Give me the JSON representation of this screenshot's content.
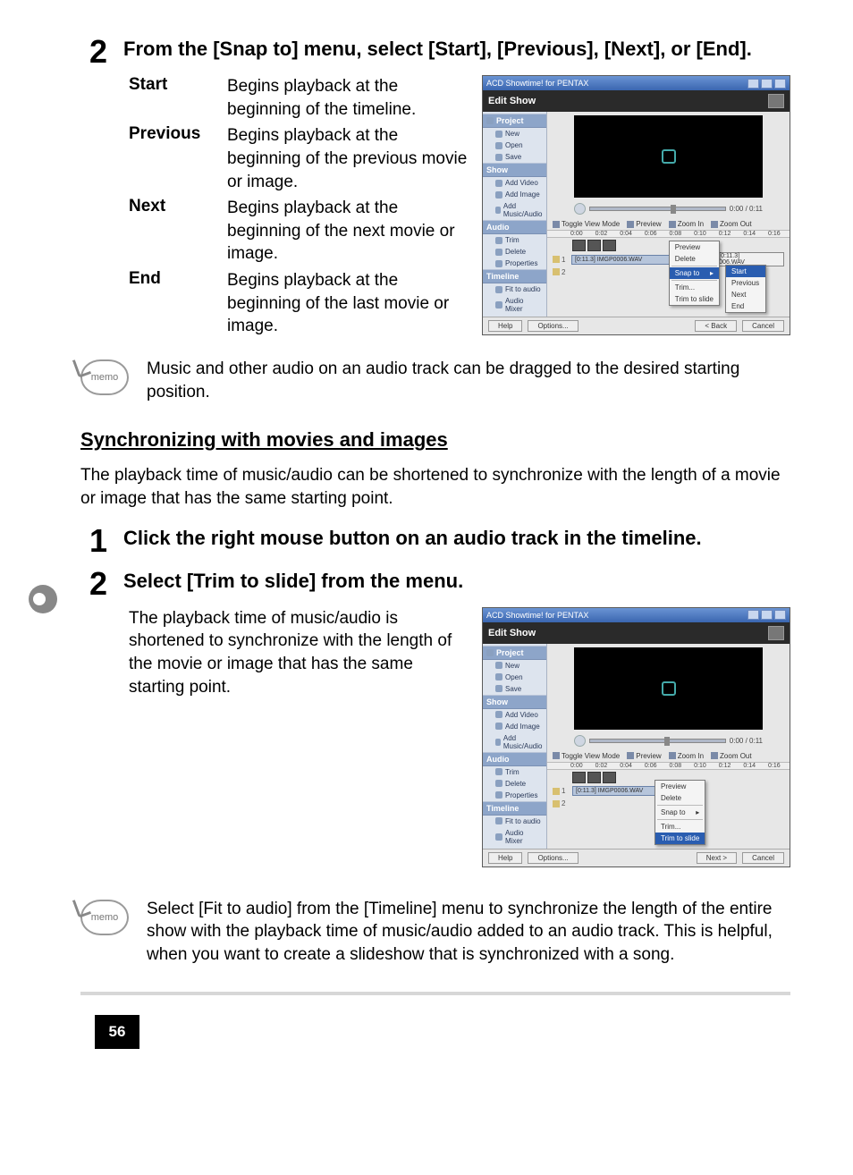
{
  "page_number": "56",
  "step2": {
    "num": "2",
    "title": "From the [Snap to] menu, select [Start], [Previous], [Next], or [End].",
    "defs": [
      {
        "term": "Start",
        "desc": "Begins playback at the beginning of the timeline."
      },
      {
        "term": "Previous",
        "desc": "Begins playback at the beginning of the previous movie or image."
      },
      {
        "term": "Next",
        "desc": "Begins playback at the beginning of the next movie or image."
      },
      {
        "term": "End",
        "desc": "Begins playback at the beginning of the last movie or image."
      }
    ]
  },
  "memo1": {
    "label": "memo",
    "text": "Music and other audio on an audio track can be dragged to the desired starting position."
  },
  "section_heading": "Synchronizing with movies and images",
  "section_intro": "The playback time of music/audio can be shortened to synchronize with the length of a movie or image that has the same starting point.",
  "sync_step1": {
    "num": "1",
    "title": "Click the right mouse button on an audio track in the timeline."
  },
  "sync_step2": {
    "num": "2",
    "title": "Select [Trim to slide] from the menu.",
    "body": "The playback time of music/audio is shortened to synchronize with the length of the movie or image that has the same starting point."
  },
  "memo2": {
    "label": "memo",
    "text": "Select [Fit to audio] from the [Timeline] menu to synchronize the length of the entire show with the playback time of music/audio added to an audio track. This is helpful, when you want to create a slideshow that is synchronized with a song."
  },
  "shot_a": {
    "title": "ACD Showtime! for PENTAX",
    "header": "Edit Show",
    "sidebar": {
      "sections": [
        {
          "name": "Project",
          "items": [
            "New",
            "Open",
            "Save"
          ]
        },
        {
          "name": "Show",
          "items": [
            "Add Video",
            "Add Image",
            "Add Music/Audio"
          ]
        },
        {
          "name": "Audio",
          "items": [
            "Trim",
            "Delete",
            "Properties"
          ]
        },
        {
          "name": "Timeline",
          "items": [
            "Fit to audio",
            "Audio Mixer"
          ]
        }
      ]
    },
    "transport_time": "0:00 / 0:11",
    "toolbar": {
      "toggle": "Toggle View Mode",
      "preview": "Preview",
      "zoom_in": "Zoom In",
      "zoom_out": "Zoom Out"
    },
    "ruler": [
      "0:00",
      "0:02",
      "0:04",
      "0:06",
      "0:08",
      "0:10",
      "0:12",
      "0:14",
      "0:16"
    ],
    "tracks": {
      "a1": "1",
      "a2": "2",
      "clip1": "[0:11.3] IMGP0006.WAV",
      "clip_info": "Audio: [0:11.3] IMGP0006.WAV"
    },
    "ctx_main": {
      "items": [
        "Preview",
        "Delete"
      ],
      "snap": "Snap to",
      "trim": "Trim...",
      "trimslide": "Trim to slide"
    },
    "ctx_snap": {
      "items": [
        "Start",
        "Previous",
        "Next",
        "End"
      ],
      "selected": "Start"
    },
    "bottom": {
      "help": "Help",
      "options": "Options...",
      "back": "< Back",
      "cancel": "Cancel"
    },
    "knob_left": "60%"
  },
  "shot_b": {
    "title": "ACD Showtime! for PENTAX",
    "header": "Edit Show",
    "sidebar": {
      "sections": [
        {
          "name": "Project",
          "items": [
            "New",
            "Open",
            "Save"
          ]
        },
        {
          "name": "Show",
          "items": [
            "Add Video",
            "Add Image",
            "Add Music/Audio"
          ]
        },
        {
          "name": "Audio",
          "items": [
            "Trim",
            "Delete",
            "Properties"
          ]
        },
        {
          "name": "Timeline",
          "items": [
            "Fit to audio",
            "Audio Mixer"
          ]
        }
      ]
    },
    "transport_time": "0:00 / 0:11",
    "toolbar": {
      "toggle": "Toggle View Mode",
      "preview": "Preview",
      "zoom_in": "Zoom In",
      "zoom_out": "Zoom Out"
    },
    "ruler": [
      "0:00",
      "0:02",
      "0:04",
      "0:06",
      "0:08",
      "0:10",
      "0:12",
      "0:14",
      "0:16"
    ],
    "tracks": {
      "a1": "1",
      "a2": "2",
      "clip1": "[0:11.3] IMGP0006.WAV"
    },
    "ctx_main": {
      "items": [
        "Preview",
        "Delete"
      ],
      "snap": "Snap to",
      "trim": "Trim...",
      "trimslide": "Trim to slide"
    },
    "bottom": {
      "help": "Help",
      "options": "Options...",
      "next": "Next >",
      "cancel": "Cancel"
    },
    "knob_left": "55%"
  }
}
